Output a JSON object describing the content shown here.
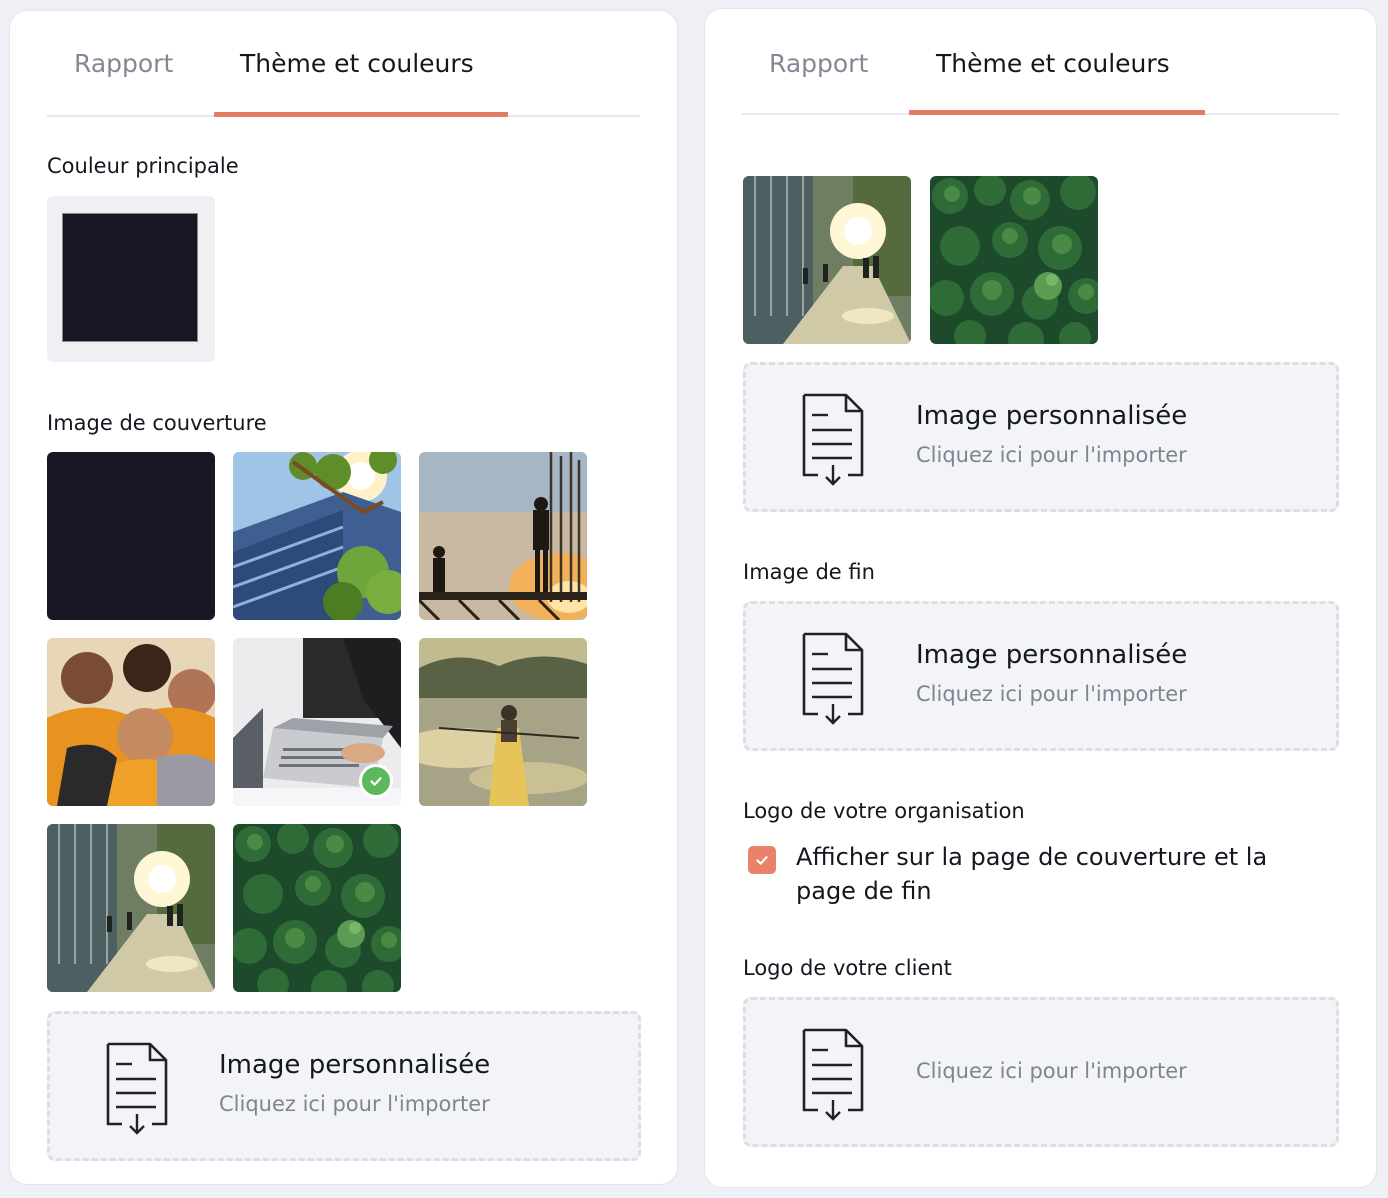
{
  "tabs": {
    "report": "Rapport",
    "theme": "Thème et couleurs"
  },
  "main_color": {
    "label": "Couleur principale",
    "value": "#161722"
  },
  "cover": {
    "label": "Image de couverture"
  },
  "thumbnails": [
    "solid-dark",
    "building-tree",
    "construction-workers",
    "team-huddle",
    "laptop-meeting",
    "rowing",
    "city-walk",
    "forest"
  ],
  "selected_thumbnail": "laptop-meeting",
  "custom_image": {
    "title": "Image personnalisée",
    "subtitle": "Cliquez ici pour l'importer"
  },
  "end_image": {
    "label": "Image de fin"
  },
  "org_logo": {
    "label": "Logo de votre organisation",
    "checkbox_label": "Afficher sur la page de couverture et la page de fin",
    "checked": true
  },
  "client_logo": {
    "label": "Logo de votre client"
  },
  "colors": {
    "accent": "#e47a63",
    "check": "#5cb85c"
  }
}
